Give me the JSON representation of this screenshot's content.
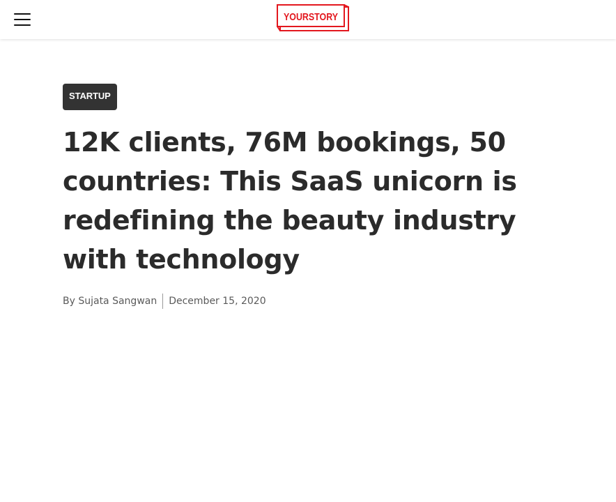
{
  "header": {
    "menu_icon": "hamburger-menu-icon",
    "logo_text": "YOURSTORY",
    "logo_color": "#e3171e"
  },
  "article": {
    "category": "STARTUP",
    "title": "12K clients, 76M bookings, 50 countries: This SaaS unicorn is redefining the beauty industry with technology",
    "byline": {
      "author": "By Sujata Sangwan",
      "date": "December 15, 2020"
    }
  },
  "colors": {
    "category_bg": "#333333",
    "title_text": "#2b2b2b",
    "byline_text": "#5a5a5a"
  }
}
